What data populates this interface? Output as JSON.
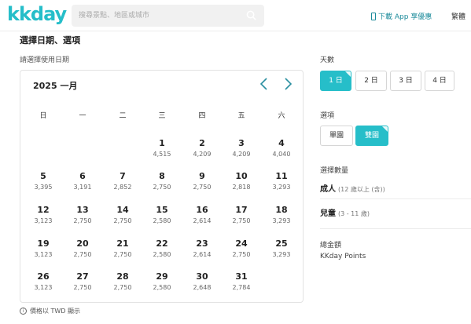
{
  "header": {
    "logo": "kkday",
    "search_placeholder": "搜尋景點、地區或城市",
    "app_link": "下載 App 享優惠",
    "language": "繁體"
  },
  "section_title": "選擇日期、選項",
  "date_prompt": "請選擇使用日期",
  "calendar": {
    "month_title": "2025 一月",
    "weekdays": [
      "日",
      "一",
      "二",
      "三",
      "四",
      "五",
      "六"
    ],
    "first_weekday_index": 3,
    "days": [
      {
        "day": "1",
        "price": "4,515"
      },
      {
        "day": "2",
        "price": "4,209"
      },
      {
        "day": "3",
        "price": "4,209"
      },
      {
        "day": "4",
        "price": "4,040"
      },
      {
        "day": "5",
        "price": "3,395"
      },
      {
        "day": "6",
        "price": "3,191"
      },
      {
        "day": "7",
        "price": "2,852"
      },
      {
        "day": "8",
        "price": "2,750"
      },
      {
        "day": "9",
        "price": "2,750"
      },
      {
        "day": "10",
        "price": "2,818"
      },
      {
        "day": "11",
        "price": "3,293"
      },
      {
        "day": "12",
        "price": "3,123"
      },
      {
        "day": "13",
        "price": "2,750"
      },
      {
        "day": "14",
        "price": "2,750"
      },
      {
        "day": "15",
        "price": "2,580"
      },
      {
        "day": "16",
        "price": "2,614"
      },
      {
        "day": "17",
        "price": "2,750"
      },
      {
        "day": "18",
        "price": "3,293"
      },
      {
        "day": "19",
        "price": "3,123"
      },
      {
        "day": "20",
        "price": "2,750"
      },
      {
        "day": "21",
        "price": "2,750"
      },
      {
        "day": "22",
        "price": "2,580"
      },
      {
        "day": "23",
        "price": "2,614"
      },
      {
        "day": "24",
        "price": "2,750"
      },
      {
        "day": "25",
        "price": "3,293"
      },
      {
        "day": "26",
        "price": "3,123"
      },
      {
        "day": "27",
        "price": "2,750"
      },
      {
        "day": "28",
        "price": "2,750"
      },
      {
        "day": "29",
        "price": "2,580"
      },
      {
        "day": "30",
        "price": "2,648"
      },
      {
        "day": "31",
        "price": "2,784"
      }
    ]
  },
  "price_note": "價格以 TWD 顯示",
  "days_section": {
    "label": "天數",
    "options": [
      "1 日",
      "2 日",
      "3 日",
      "4 日"
    ],
    "selected_index": 0
  },
  "options_section": {
    "label": "選項",
    "options": [
      "單園",
      "雙園"
    ],
    "selected_index": 1
  },
  "quantity_section": {
    "label": "選擇數量",
    "adult_label": "成人",
    "adult_note": "(12 歲以上 (含))",
    "child_label": "兒童",
    "child_note": "(3 - 11 歲)"
  },
  "total": {
    "label": "總金額",
    "points_label": "KKday Points"
  },
  "colors": {
    "accent": "#26bec9",
    "link": "#1a8a9a"
  },
  "icons": {
    "search": "search-icon",
    "phone": "phone-icon",
    "prev": "chevron-left-icon",
    "next": "chevron-right-icon",
    "info": "info-icon"
  }
}
